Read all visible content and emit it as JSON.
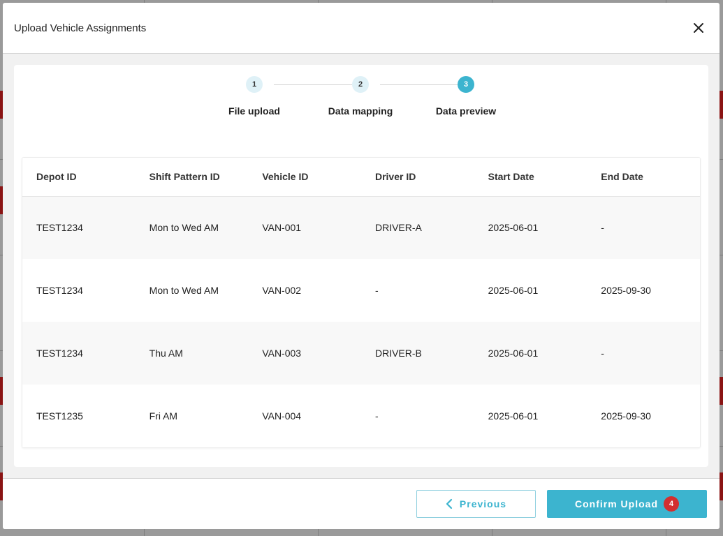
{
  "modal": {
    "title": "Upload Vehicle Assignments"
  },
  "stepper": {
    "steps": [
      {
        "number": "1",
        "label": "File upload",
        "state": "completed"
      },
      {
        "number": "2",
        "label": "Data mapping",
        "state": "completed"
      },
      {
        "number": "3",
        "label": "Data preview",
        "state": "active"
      }
    ]
  },
  "table": {
    "headers": [
      "Depot ID",
      "Shift Pattern ID",
      "Vehicle ID",
      "Driver ID",
      "Start Date",
      "End Date"
    ],
    "rows": [
      [
        "TEST1234",
        "Mon to Wed AM",
        "VAN-001",
        "DRIVER-A",
        "2025-06-01",
        "-"
      ],
      [
        "TEST1234",
        "Mon to Wed AM",
        "VAN-002",
        "-",
        "2025-06-01",
        "2025-09-30"
      ],
      [
        "TEST1234",
        "Thu AM",
        "VAN-003",
        "DRIVER-B",
        "2025-06-01",
        "-"
      ],
      [
        "TEST1235",
        "Fri AM",
        "VAN-004",
        "-",
        "2025-06-01",
        "2025-09-30"
      ]
    ]
  },
  "footer": {
    "previous_label": "Previous",
    "confirm_label": "Confirm Upload",
    "confirm_badge": "4"
  },
  "icons": {
    "close": "close-icon",
    "previous": "chevron-left-icon"
  },
  "colors": {
    "accent": "#3cb4cf",
    "badge": "#d32f2f"
  }
}
